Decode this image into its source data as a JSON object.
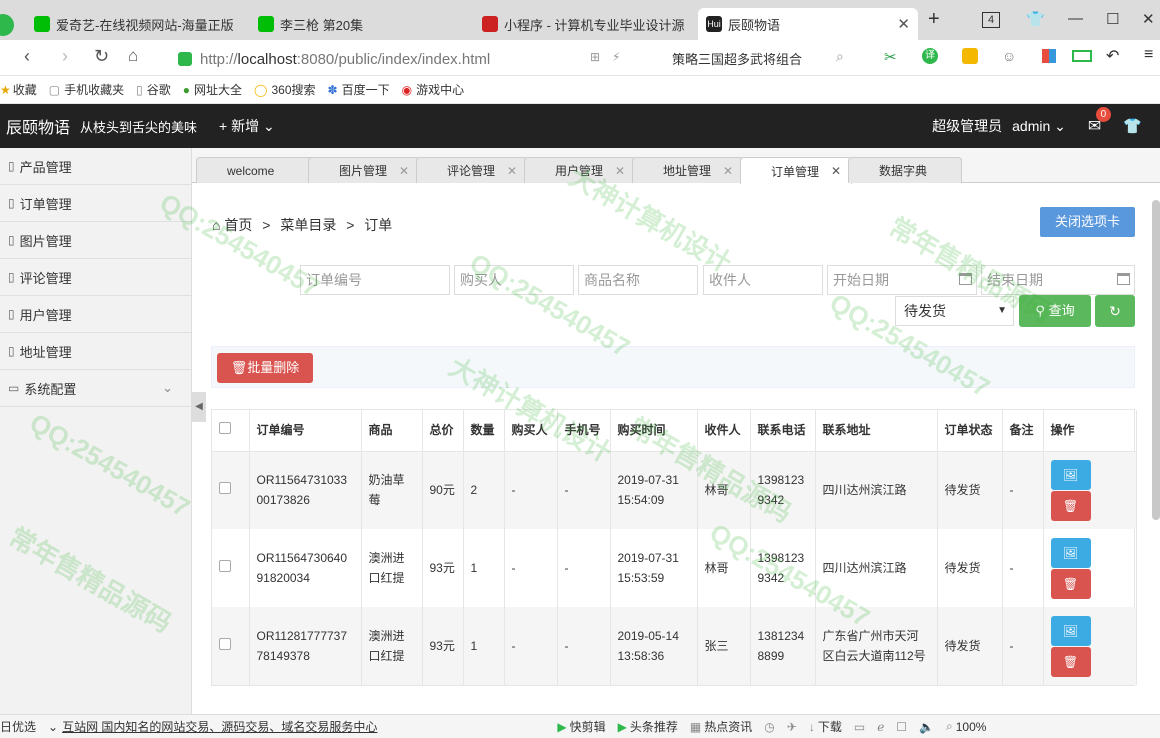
{
  "browser": {
    "tabs": [
      {
        "title": "爱奇艺-在线视频网站-海量正版",
        "color": "#00be06"
      },
      {
        "title": "李三枪 第20集",
        "color": "#00be06"
      },
      {
        "title": "小程序 - 计算机专业毕业设计源",
        "color": "#cc2222"
      },
      {
        "title": "辰颐物语",
        "color": "#222222",
        "favicon_text": "Hui"
      }
    ],
    "tab_count": "4",
    "url_prefix": "http://",
    "url_host": "localhost",
    "url_rest": ":8080/public/index/index.html",
    "search_hint": "策略三国超多武将组合",
    "bookmarks": [
      "收藏",
      "手机收藏夹",
      "谷歌",
      "网址大全",
      "360搜索",
      "百度一下",
      "游戏中心"
    ]
  },
  "header": {
    "logo": "辰颐物语",
    "slogan": "从枝头到舌尖的美味",
    "new_label": "新增",
    "role": "超级管理员",
    "user": "admin",
    "msg_count": "0"
  },
  "sidebar": {
    "items": [
      "产品管理",
      "订单管理",
      "图片管理",
      "评论管理",
      "用户管理",
      "地址管理",
      "系统配置"
    ]
  },
  "page_tabs": [
    "welcome",
    "图片管理",
    "评论管理",
    "用户管理",
    "地址管理",
    "订单管理",
    "数据字典"
  ],
  "breadcrumb": {
    "home": "首页",
    "sep": ">",
    "level1": "菜单目录",
    "level2": "订单"
  },
  "close_tab_label": "关闭选项卡",
  "filters": {
    "order_no": "订单编号",
    "buyer": "购买人",
    "product": "商品名称",
    "receiver": "收件人",
    "start_date": "开始日期",
    "end_date": "结束日期",
    "status": "待发货",
    "query_label": "查询"
  },
  "batch_delete_label": "批量删除",
  "table": {
    "headers": [
      "订单编号",
      "商品",
      "总价",
      "数量",
      "购买人",
      "手机号",
      "购买时间",
      "收件人",
      "联系电话",
      "联系地址",
      "订单状态",
      "备注",
      "操作"
    ],
    "rows": [
      [
        "OR1156473103300173826",
        "奶油草莓",
        "90元",
        "2",
        "-",
        "-",
        "2019-07-31 15:54:09",
        "林哥",
        "13981239342",
        "四川达州滨江路",
        "待发货",
        "-"
      ],
      [
        "OR1156473064091820034",
        "澳洲进口红提",
        "93元",
        "1",
        "-",
        "-",
        "2019-07-31 15:53:59",
        "林哥",
        "13981239342",
        "四川达州滨江路",
        "待发货",
        "-"
      ],
      [
        "OR1128177773778149378",
        "澳洲进口红提",
        "93元",
        "1",
        "-",
        "-",
        "2019-05-14 13:58:36",
        "张三",
        "13812348899",
        "广东省广州市天河区白云大道南112号",
        "待发货",
        "-"
      ]
    ]
  },
  "statusbar": {
    "items": [
      "日优选",
      "互站网 国内知名的网站交易、源码交易、域名交易服务中心",
      "快剪辑",
      "头条推荐",
      "热点资讯",
      "下载",
      "100%"
    ]
  },
  "watermarks": [
    "QQ:254540457",
    "常年售精品源码",
    "大神计算机设计"
  ]
}
